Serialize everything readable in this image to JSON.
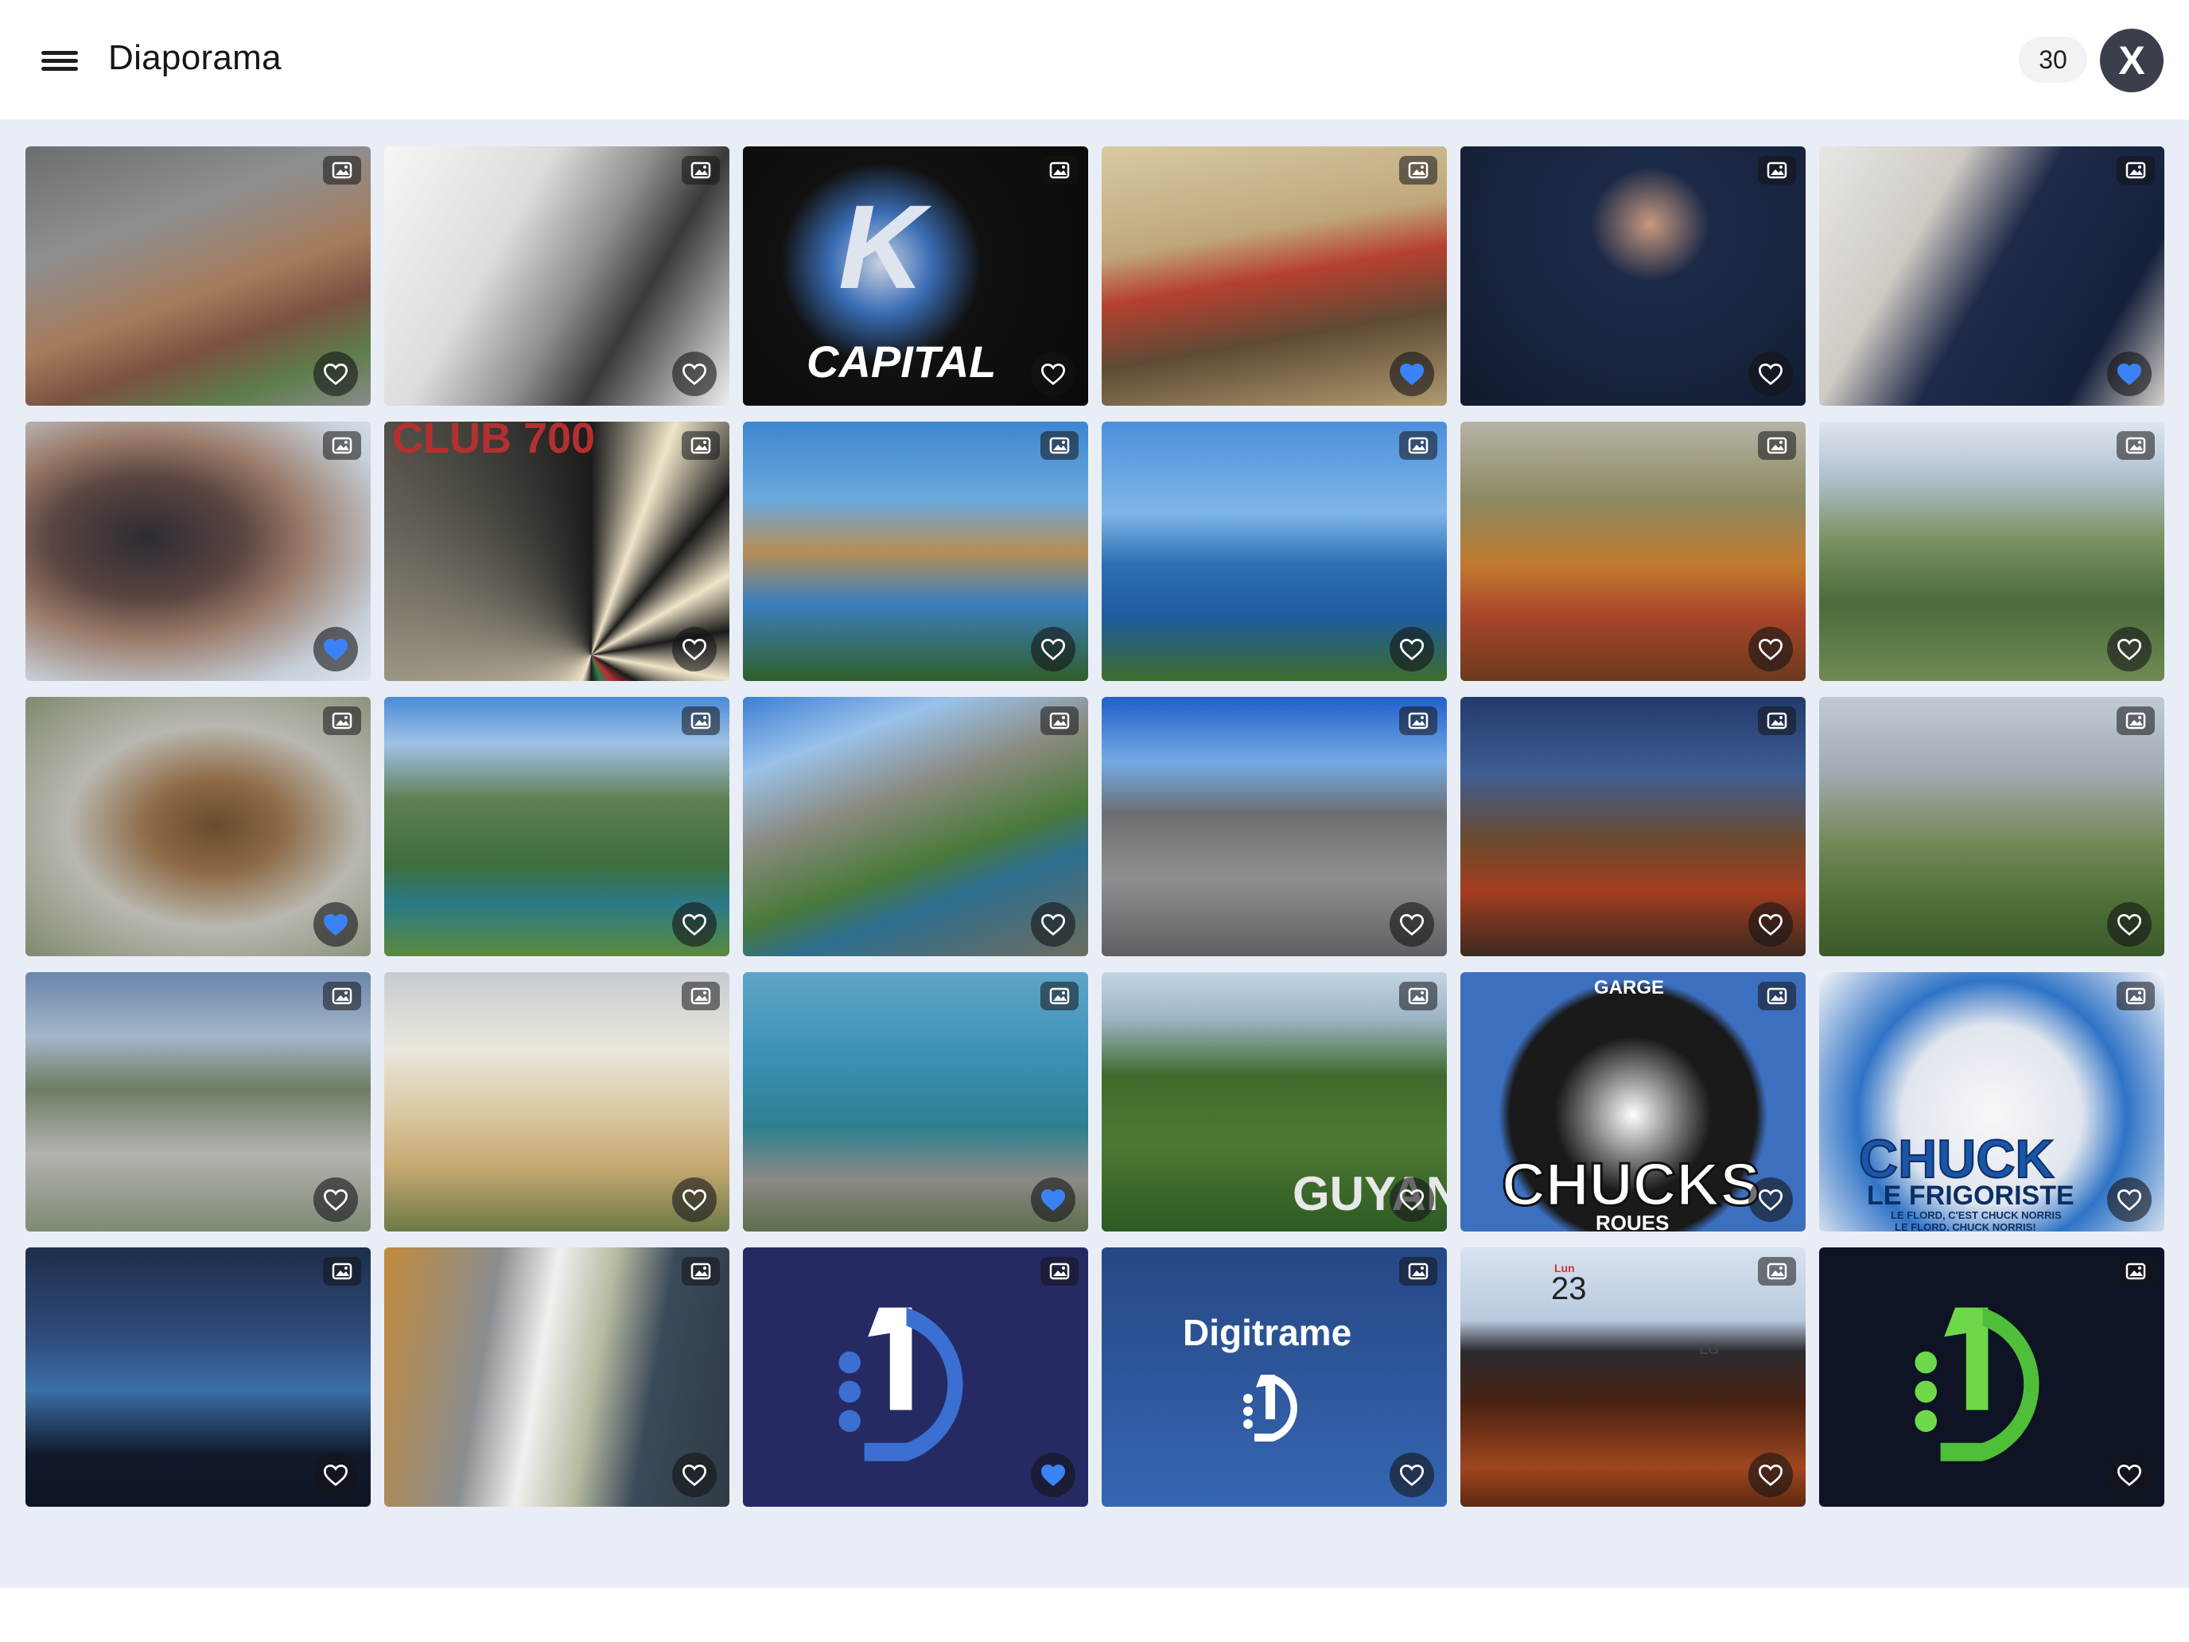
{
  "header": {
    "title": "Diaporama",
    "count": "30",
    "close_label": "X"
  },
  "colors": {
    "background": "#e9edf5",
    "favorite_active": "#3b82f6",
    "icon_bg": "#141418"
  },
  "gallery": {
    "tiles": [
      {
        "favorite": false,
        "overlay": ""
      },
      {
        "favorite": false,
        "overlay": ""
      },
      {
        "favorite": false,
        "overlay": "CAPITAL"
      },
      {
        "favorite": true,
        "overlay": ""
      },
      {
        "favorite": false,
        "overlay": ""
      },
      {
        "favorite": true,
        "overlay": ""
      },
      {
        "favorite": true,
        "overlay": ""
      },
      {
        "favorite": false,
        "overlay": "CLUB 700"
      },
      {
        "favorite": false,
        "overlay": ""
      },
      {
        "favorite": false,
        "overlay": ""
      },
      {
        "favorite": false,
        "overlay": ""
      },
      {
        "favorite": false,
        "overlay": ""
      },
      {
        "favorite": true,
        "overlay": ""
      },
      {
        "favorite": false,
        "overlay": ""
      },
      {
        "favorite": false,
        "overlay": ""
      },
      {
        "favorite": false,
        "overlay": ""
      },
      {
        "favorite": false,
        "overlay": ""
      },
      {
        "favorite": false,
        "overlay": ""
      },
      {
        "favorite": false,
        "overlay": ""
      },
      {
        "favorite": false,
        "overlay": ""
      },
      {
        "favorite": true,
        "overlay": ""
      },
      {
        "favorite": false,
        "overlay": "GUYAN"
      },
      {
        "favorite": false,
        "overlay": "CHUCKS"
      },
      {
        "favorite": false,
        "overlay": "CHUCK"
      },
      {
        "favorite": false,
        "overlay": ""
      },
      {
        "favorite": false,
        "overlay": ""
      },
      {
        "favorite": true,
        "overlay": ""
      },
      {
        "favorite": false,
        "overlay": "Digitrame"
      },
      {
        "favorite": false,
        "overlay": "23"
      },
      {
        "favorite": false,
        "overlay": ""
      }
    ],
    "tile_texts": {
      "kcapital": "CAPITAL",
      "dart": "CLUB 700",
      "guyane": "GUYAN",
      "chucks_top": "GARGE",
      "chucks": "CHUCKS",
      "chucks_bottom": "ROUES",
      "chuck": "CHUCK",
      "chuck_sub": "LE FRIGORISTE",
      "chuck_line": "LE FLORD, C'EST CHUCK NORRIS",
      "chuck_line2": "LE FLORD, CHUCK NORRIS!",
      "digitrame": "Digitrame",
      "desk_date": "23",
      "desk_day": "Lun",
      "desk_brand": "LG",
      "kcapital_letter": "K"
    }
  }
}
